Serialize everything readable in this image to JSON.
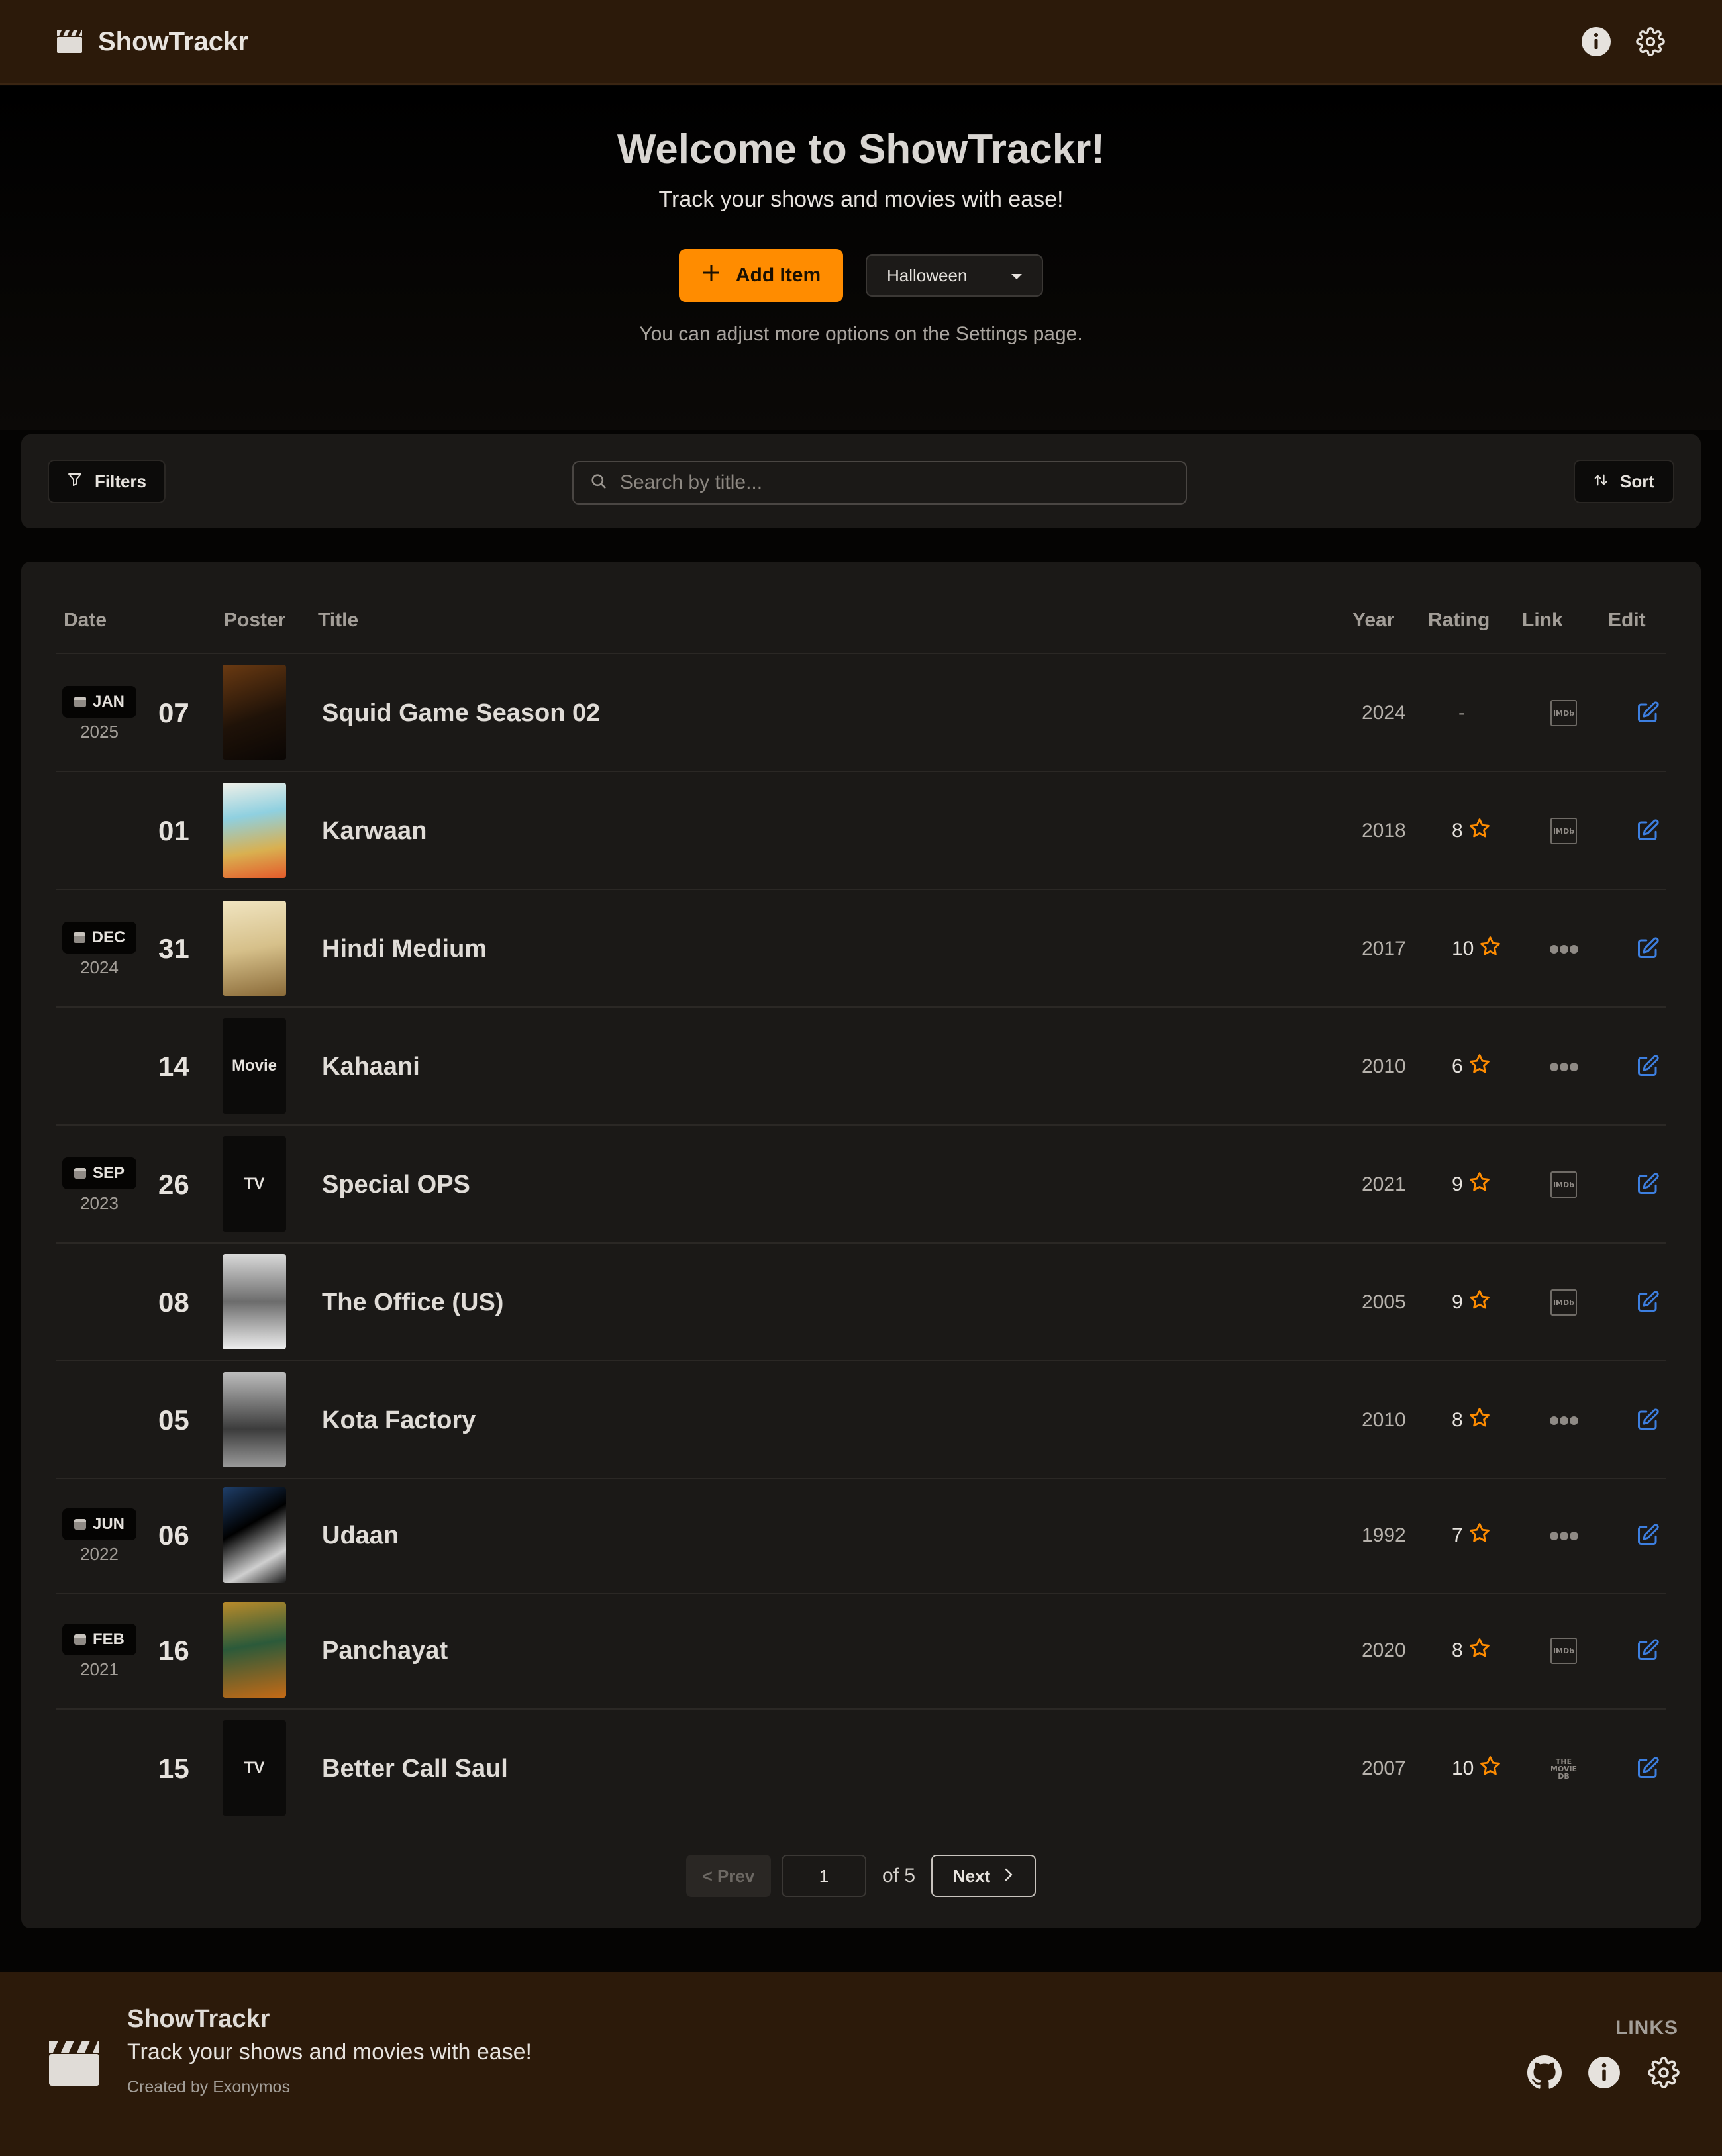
{
  "app": {
    "name": "ShowTrackr"
  },
  "header": {
    "icons": [
      "clapperboard-icon",
      "info-icon",
      "gear-icon"
    ]
  },
  "hero": {
    "title": "Welcome to ShowTrackr!",
    "subtitle": "Track your shows and movies with ease!",
    "add_label": "Add Item",
    "theme_value": "Halloween",
    "note": "You can adjust more options on the Settings page."
  },
  "toolbar": {
    "filters_label": "Filters",
    "search_placeholder": "Search by title...",
    "search_value": "",
    "sort_label": "Sort"
  },
  "table": {
    "columns": {
      "date": "Date",
      "poster": "Poster",
      "title": "Title",
      "year": "Year",
      "rating": "Rating",
      "link": "Link",
      "edit": "Edit"
    },
    "rows": [
      {
        "month": "JAN",
        "year_group": "2025",
        "day": "07",
        "poster_label": "",
        "title": "Squid Game Season 02",
        "year": "2024",
        "rating": "-",
        "link_type": "imdb"
      },
      {
        "month": "",
        "year_group": "",
        "day": "01",
        "poster_label": "",
        "title": "Karwaan",
        "year": "2018",
        "rating": "8",
        "link_type": "imdb"
      },
      {
        "month": "DEC",
        "year_group": "2024",
        "day": "31",
        "poster_label": "",
        "title": "Hindi Medium",
        "year": "2017",
        "rating": "10",
        "link_type": "dots"
      },
      {
        "month": "",
        "year_group": "",
        "day": "14",
        "poster_label": "Movie",
        "title": "Kahaani",
        "year": "2010",
        "rating": "6",
        "link_type": "dots"
      },
      {
        "month": "SEP",
        "year_group": "2023",
        "day": "26",
        "poster_label": "TV",
        "title": "Special OPS",
        "year": "2021",
        "rating": "9",
        "link_type": "imdb"
      },
      {
        "month": "",
        "year_group": "",
        "day": "08",
        "poster_label": "",
        "title": "The Office (US)",
        "year": "2005",
        "rating": "9",
        "link_type": "imdb"
      },
      {
        "month": "",
        "year_group": "",
        "day": "05",
        "poster_label": "",
        "title": "Kota Factory",
        "year": "2010",
        "rating": "8",
        "link_type": "dots"
      },
      {
        "month": "JUN",
        "year_group": "2022",
        "day": "06",
        "poster_label": "",
        "title": "Udaan",
        "year": "1992",
        "rating": "7",
        "link_type": "dots"
      },
      {
        "month": "FEB",
        "year_group": "2021",
        "day": "16",
        "poster_label": "",
        "title": "Panchayat",
        "year": "2020",
        "rating": "8",
        "link_type": "imdb"
      },
      {
        "month": "",
        "year_group": "",
        "day": "15",
        "poster_label": "TV",
        "title": "Better Call Saul",
        "year": "2007",
        "rating": "10",
        "link_type": "tmdb"
      }
    ],
    "imdb_text": "IMDb",
    "tmdb_lines": [
      "THE",
      "MOVIE",
      "DB"
    ]
  },
  "pagination": {
    "prev_label": "< Prev",
    "current_page": "1",
    "of_text": "of 5",
    "next_label": "Next"
  },
  "footer": {
    "brand": "ShowTrackr",
    "tagline": "Track your shows and movies with ease!",
    "credit": "Created by Exonymos",
    "links_label": "LINKS",
    "icons": [
      "github-icon",
      "info-icon",
      "gear-icon"
    ]
  },
  "colors": {
    "accent": "#ff8c00",
    "header_bg": "#2c1a0a",
    "card_bg": "#1b1917",
    "edit_icon": "#3d7fe0"
  }
}
